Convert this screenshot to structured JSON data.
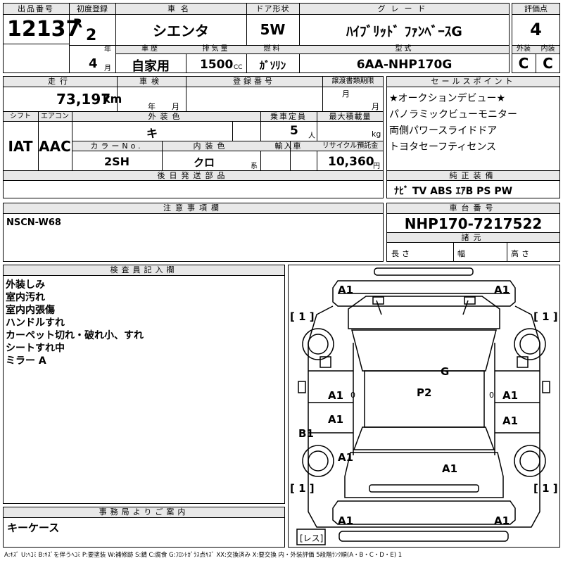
{
  "labels": {
    "lot_no": "出品番号",
    "first_reg": "初度登録",
    "car_name": "車名",
    "door": "ドア形状",
    "grade": "グレード",
    "score": "評価点",
    "history": "車歴",
    "displacement": "排気量",
    "fuel": "燃料",
    "model": "型式",
    "exterior": "外装",
    "interior": "内装",
    "mileage": "走行",
    "inspection": "車検",
    "reg_no": "登録番号",
    "transfer_deadline": "譲渡書類期限",
    "sales_points": "セールスポイント",
    "shift": "シフト",
    "aircon": "エアコン",
    "ext_color": "外装色",
    "capacity": "乗車定員",
    "max_load": "最大積載量",
    "color_no": "カラーNo.",
    "int_color": "内装色",
    "import": "輸入車",
    "recycle": "リサイクル預託金",
    "later_parts": "後日発送部品",
    "genuine": "純正装備",
    "notes": "注意事項欄",
    "chassis": "車台番号",
    "specs": "諸元",
    "length": "長さ",
    "width": "幅",
    "height": "高さ",
    "inspector": "検査員記入欄",
    "office": "事務局よりご案内"
  },
  "units": {
    "year": "年",
    "month": "月",
    "cc": "CC",
    "km": "km",
    "persons": "人",
    "kg": "kg",
    "series": "系",
    "yen": "円"
  },
  "values": {
    "lot_no": "12137",
    "era": "R",
    "year": "2",
    "month": "4",
    "car_name": "シエンタ",
    "door": "5W",
    "grade": "ﾊｲﾌﾞﾘｯﾄﾞ ﾌｧﾝﾍﾞｰｽG",
    "score": "4",
    "history": "自家用",
    "displacement": "1500",
    "fuel": "ｶﾞｿﾘﾝ",
    "model": "6AA-NHP170G",
    "exterior": "C",
    "interior": "C",
    "mileage": "73,197",
    "shift": "IAT",
    "aircon": "AAC",
    "ext_color": "キ",
    "capacity": "5",
    "color_no": "2SH",
    "int_color": "クロ",
    "recycle": "10,360",
    "genuine": "ﾅﾋﾞ TV ABS ｴｱB PS PW",
    "notes": "NSCN-W68",
    "chassis": "NHP170-7217522",
    "office": "キーケース"
  },
  "sales_points": [
    "★オークションデビュー★",
    "パノラミックビューモニター",
    "両側パワースライドドア",
    "トヨタセーフティセンス"
  ],
  "inspector_notes": [
    "外装しみ",
    "室内汚れ",
    "室内内張傷",
    "ハンドルすれ",
    "カーペット切れ・破れ小、すれ",
    "シートすれ中",
    "ミラー A"
  ],
  "diagram": {
    "a1_tl": "A1",
    "a1_tr": "A1",
    "a1_ml": "A1",
    "a1_mr": "A1",
    "a1_ml2": "A1",
    "a1_mr2": "A1",
    "a1_rear_l": "A1",
    "a1_rear": "A1",
    "a1_bl": "A1",
    "a1_br": "A1",
    "g": "G",
    "p2": "P2",
    "b1": "B1",
    "zero_l": "0",
    "zero_r": "0",
    "tire_fl": "[ 1 ]",
    "tire_fr": "[ 1 ]",
    "tire_rl": "[ 1 ]",
    "tire_rr": "[ 1 ]",
    "spare": "[レス]"
  },
  "legend": "A:ｷｽﾞ U:ﾍｺﾐ B:ｷｽﾞを伴うﾍｺﾐ P:要塗装 W:補修跡 S:錆 C:腐食 G:ﾌﾛﾝﾄｶﾞﾗｽ点ｷｽﾞ XX:交換済み X:要交換 内・外装評価 5段階ﾗﾝｸ順(A・B・C・D・E) 1"
}
